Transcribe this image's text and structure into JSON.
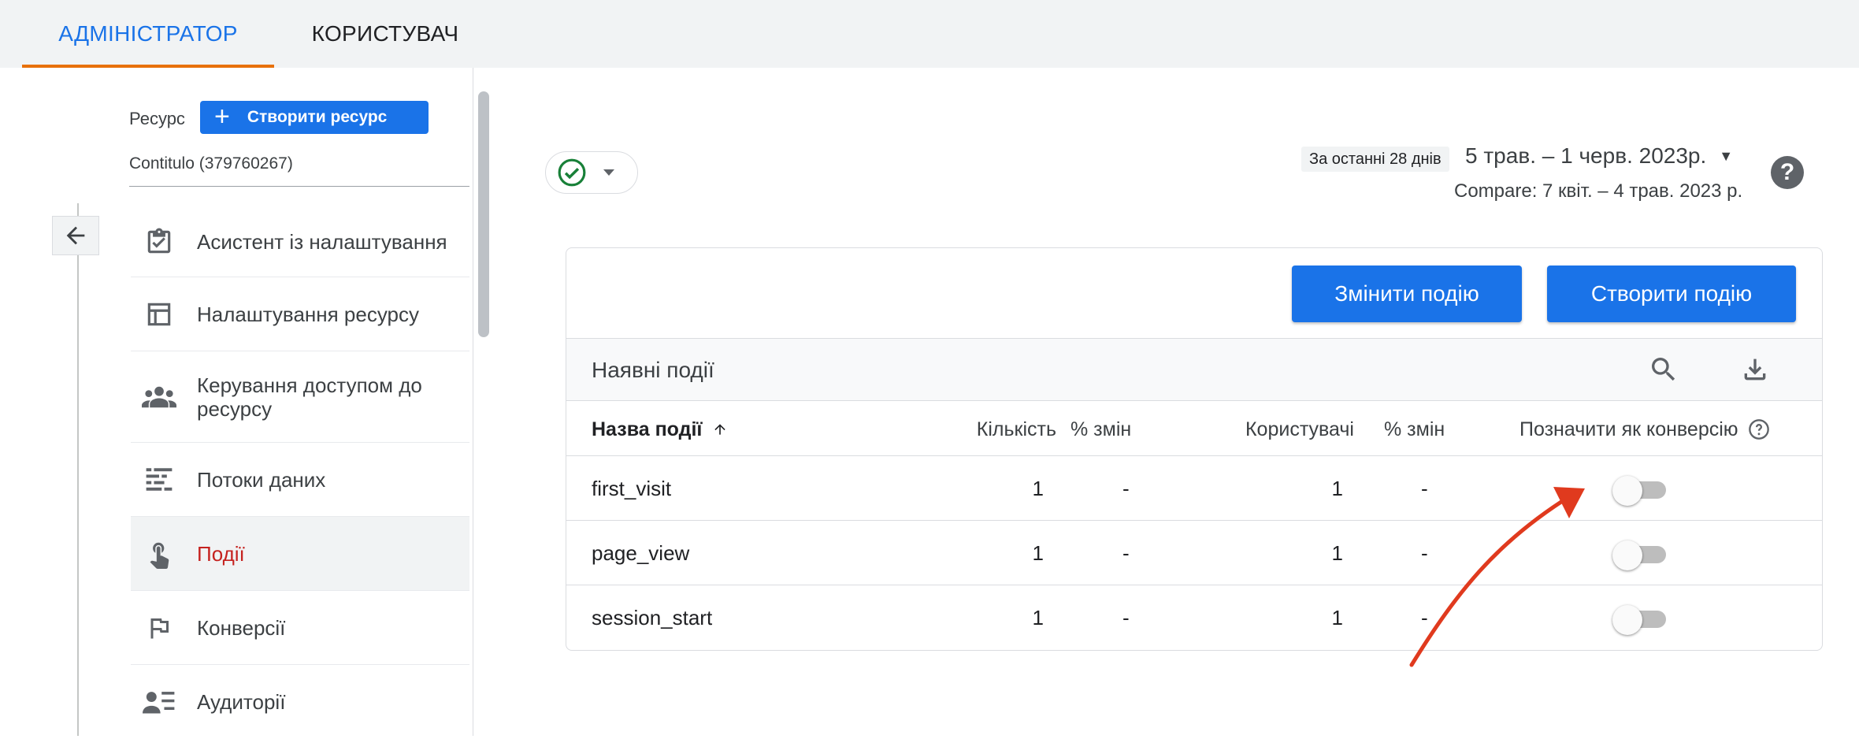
{
  "tabs": {
    "admin": "АДМІНІСТРАТОР",
    "user": "КОРИСТУВАЧ"
  },
  "resource": {
    "label": "Ресурс",
    "create_button": "Створити ресурс",
    "selected": "Contitulo (379760267)"
  },
  "sidebar": {
    "items": [
      {
        "label": "Асистент із налаштування",
        "icon": "clipboard-check-icon"
      },
      {
        "label": "Налаштування ресурсу",
        "icon": "layout-icon"
      },
      {
        "label": "Керування доступом до ресурсу",
        "icon": "people-icon"
      },
      {
        "label": "Потоки даних",
        "icon": "streams-icon"
      },
      {
        "label": "Події",
        "icon": "touch-icon",
        "active": true
      },
      {
        "label": "Конверсії",
        "icon": "flag-icon"
      },
      {
        "label": "Аудиторії",
        "icon": "audience-icon"
      }
    ]
  },
  "header": {
    "date_badge": "За останні 28 днів",
    "date_range": "5 трав. – 1 черв. 2023р.",
    "compare": "Compare: 7 квіт. – 4 трав. 2023 р."
  },
  "actions": {
    "edit_event": "Змінити подію",
    "create_event": "Створити подію"
  },
  "table": {
    "title": "Наявні події",
    "columns": {
      "name": "Назва події",
      "count": "Кількість",
      "count_change": "% змін",
      "users": "Користувачі",
      "users_change": "% змін",
      "conversion": "Позначити як конверсію"
    },
    "rows": [
      {
        "name": "first_visit",
        "count": "1",
        "count_change": "-",
        "users": "1",
        "users_change": "-",
        "conversion": false
      },
      {
        "name": "page_view",
        "count": "1",
        "count_change": "-",
        "users": "1",
        "users_change": "-",
        "conversion": false
      },
      {
        "name": "session_start",
        "count": "1",
        "count_change": "-",
        "users": "1",
        "users_change": "-",
        "conversion": false
      }
    ]
  },
  "colors": {
    "primary": "#1a73e8",
    "active_nav": "#c5221f",
    "tab_underline": "#e8710a",
    "annotation_arrow": "#e03a1e",
    "status_ok": "#188038"
  }
}
